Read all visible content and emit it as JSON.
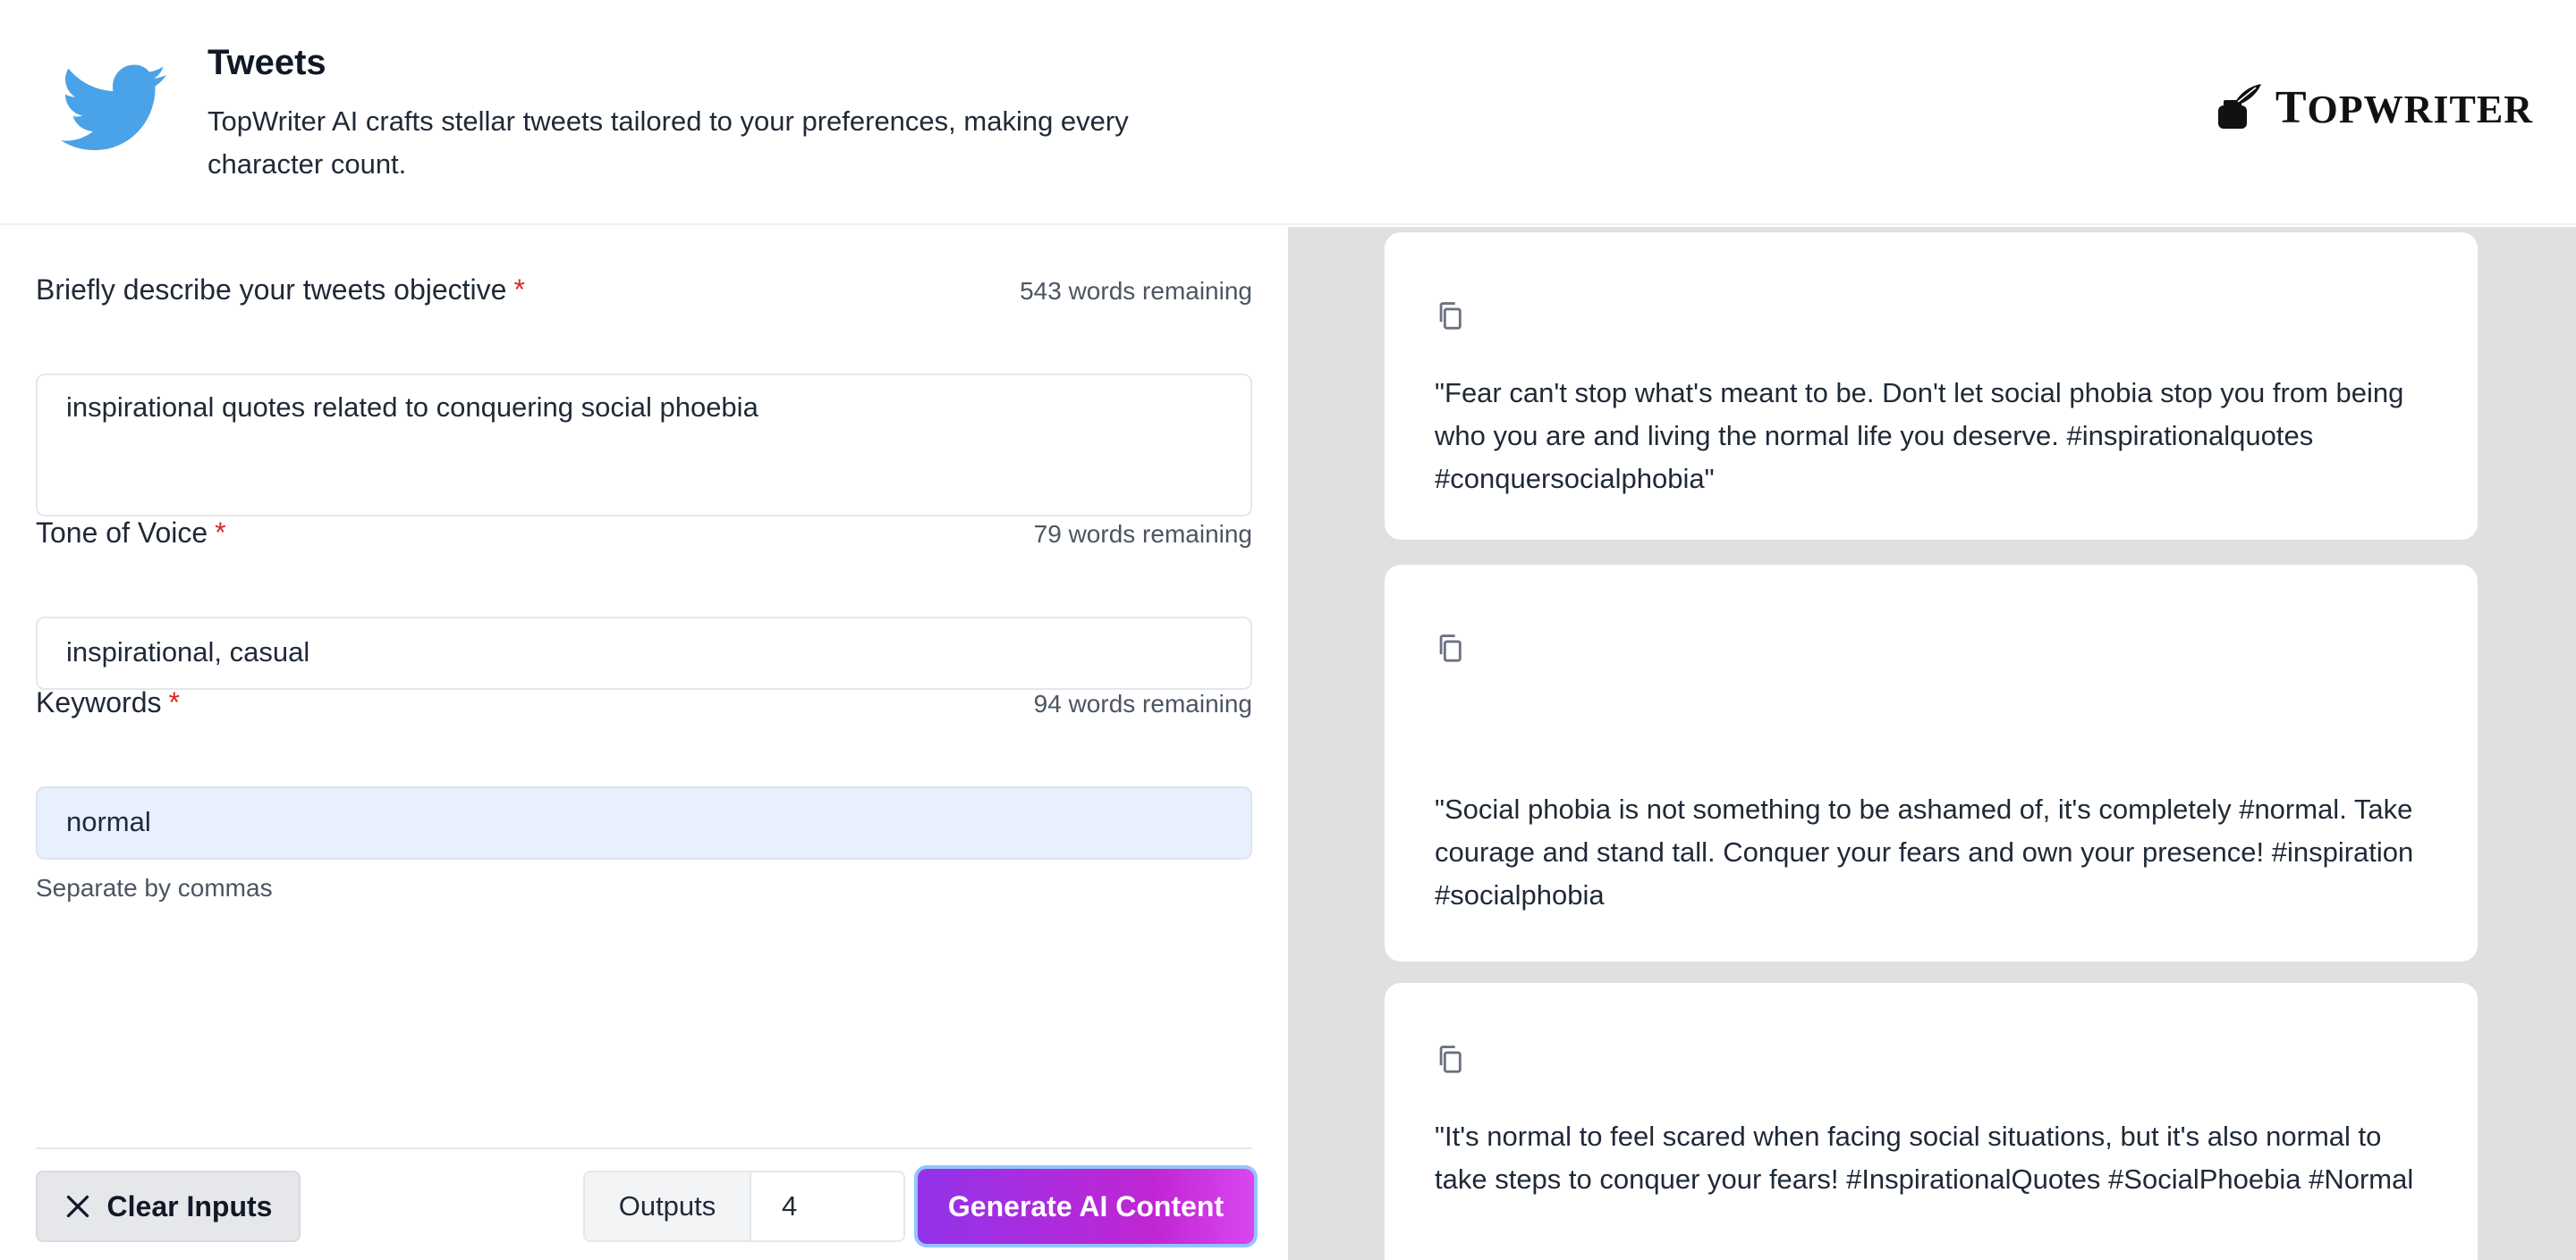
{
  "header": {
    "title": "Tweets",
    "subtitle": "TopWriter AI crafts stellar tweets tailored to your preferences, making every character count.",
    "brand_big_t": "T",
    "brand_rest": "OPWRITER"
  },
  "form": {
    "objective": {
      "label": "Briefly describe your tweets objective",
      "required_mark": "*",
      "remaining": "543 words remaining",
      "value": "inspirational quotes related to conquering social phoebia"
    },
    "tone": {
      "label": "Tone of Voice",
      "required_mark": "*",
      "remaining": "79 words remaining",
      "value": "inspirational, casual"
    },
    "keywords": {
      "label": "Keywords",
      "required_mark": "*",
      "remaining": "94 words remaining",
      "value": "normal",
      "hint": "Separate by commas"
    }
  },
  "footer": {
    "clear_label": "Clear Inputs",
    "outputs_label": "Outputs",
    "outputs_value": "4",
    "generate_label": "Generate AI Content"
  },
  "results": [
    {
      "text": "\"Fear can't stop what's meant to be. Don't let social phobia stop you from being who you are and living the normal life you deserve. #inspirationalquotes #conquersocialphobia\""
    },
    {
      "text": "\"Social phobia is not something to be ashamed of, it's completely #normal. Take courage and stand tall. Conquer your fears and own your presence! #inspiration #socialphobia"
    },
    {
      "text": "\"It's normal to feel scared when facing social situations, but it's also normal to take steps to conquer your fears! #InspirationalQuotes #SocialPhoebia #Normal"
    }
  ],
  "colors": {
    "accent_start": "#9333ea",
    "accent_end": "#d946ef",
    "twitter_blue": "#4aa3e8",
    "required": "#dc2626"
  },
  "icons": {
    "header": "twitter-bird-icon",
    "brand": "inkwell-quill-icon",
    "clear": "close-icon",
    "copy": "copy-icon"
  }
}
